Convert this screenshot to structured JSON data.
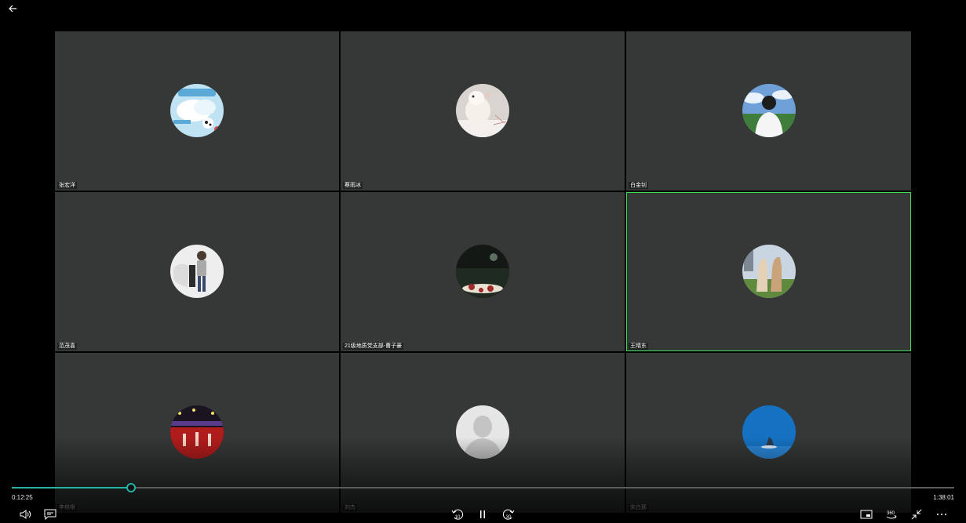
{
  "participants": [
    {
      "name": "张宏洋",
      "avatar": "cloud-sticker"
    },
    {
      "name": "蔡雨冰",
      "avatar": "plush-toy"
    },
    {
      "name": "白金钊",
      "avatar": "person-back"
    },
    {
      "name": "范茂喜",
      "avatar": "person-standing"
    },
    {
      "name": "21级地质党支部-曹子豪",
      "avatar": "dark-scene"
    },
    {
      "name": "王晴东",
      "avatar": "alpacas",
      "active": true
    },
    {
      "name": "李林根",
      "avatar": "red-stage"
    },
    {
      "name": "刘杰",
      "avatar": "default-person"
    },
    {
      "name": "宋白那",
      "avatar": "blue-sea"
    }
  ],
  "player": {
    "elapsed": "0:12:25",
    "total": "1:38:01",
    "progress": 0.1267,
    "rewind_seconds": "10",
    "forward_seconds": "30",
    "accent_color": "#22b3a4"
  },
  "highlight_color": "#3ddc5c"
}
